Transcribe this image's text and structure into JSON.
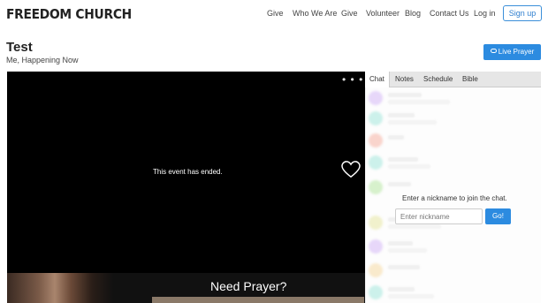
{
  "header": {
    "logo": "FREEDOM CHURCH",
    "nav": [
      "Give",
      "Who We Are",
      "Give",
      "Volunteer",
      "Blog",
      "Contact Us",
      "Log in"
    ],
    "signup_label": "Sign up"
  },
  "event": {
    "title": "Test",
    "subtitle": "Me, Happening Now",
    "live_prayer_label": "Live Prayer"
  },
  "player": {
    "menu_glyph": "• • •",
    "status": "This event has ended.",
    "promo_text": "Need Prayer?"
  },
  "sidebar": {
    "tabs": [
      "Chat",
      "Notes",
      "Schedule",
      "Bible"
    ],
    "active_tab": "Chat",
    "join_message": "Enter a nickname to join the chat.",
    "nickname_placeholder": "Enter nickname",
    "go_label": "Go!",
    "avatar_colors": [
      "#c9a6f2",
      "#8fe0d2",
      "#f2a08f",
      "#8fe0d2",
      "#a6e08f",
      "#e0e08f",
      "#c9a6f2",
      "#f2d08f",
      "#8fe0d2"
    ]
  },
  "colors": {
    "accent": "#2c8be0",
    "video_bg": "#000000"
  }
}
